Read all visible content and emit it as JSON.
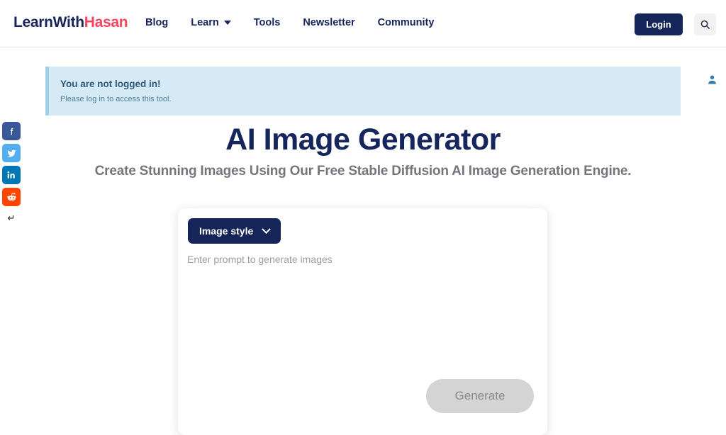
{
  "navbar": {
    "brand_part1": "LearnWith",
    "brand_part2": "Hasan",
    "links": [
      {
        "label": "Blog",
        "has_caret": false
      },
      {
        "label": "Learn",
        "has_caret": true
      },
      {
        "label": "Tools",
        "has_caret": false
      },
      {
        "label": "Newsletter",
        "has_caret": false
      },
      {
        "label": "Community",
        "has_caret": false
      }
    ],
    "login_label": "Login",
    "search_icon": "search-icon",
    "brand_navy": "#16255c",
    "brand_pink": "#f9435f"
  },
  "social_rail": {
    "items": [
      {
        "name": "facebook-icon",
        "glyph": "f",
        "color": "#3b5998"
      },
      {
        "name": "twitter-icon",
        "glyph": "t",
        "color": "#55acee"
      },
      {
        "name": "linkedin-icon",
        "glyph": "in",
        "color": "#0077b5"
      },
      {
        "name": "reddit-icon",
        "glyph": "r",
        "color": "#ff4500"
      }
    ],
    "more_glyph": "↵"
  },
  "alert": {
    "title": "You are not logged in!",
    "subtitle": "Please log in to access this tool.",
    "icon": "user-icon",
    "background": "#d6eaf5",
    "border_color": "#9ed0e8"
  },
  "hero": {
    "title": "AI Image Generator",
    "subtitle": "Create Stunning Images Using Our Free Stable Diffusion AI Image Generation Engine."
  },
  "tool": {
    "style_button_label": "Image style",
    "style_button_icon": "chevron-down-icon",
    "prompt_placeholder": "Enter prompt to generate images",
    "prompt_value": "",
    "generate_label": "Generate",
    "generate_disabled": true
  }
}
